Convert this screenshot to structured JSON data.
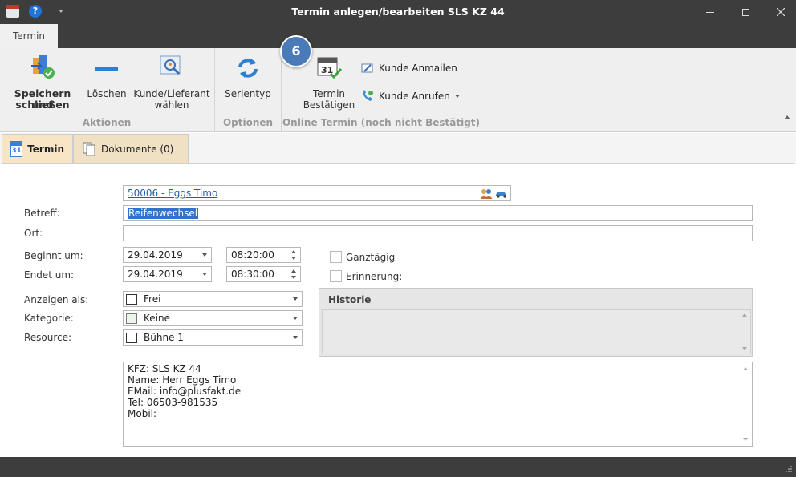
{
  "window": {
    "title": "Termin anlegen/bearbeiten SLS KZ 44"
  },
  "ribbon": {
    "tab": "Termin",
    "badge": "6",
    "groups": {
      "aktionen": "Aktionen",
      "optionen": "Optionen",
      "online": "Online Termin (noch nicht Bestätigt)"
    },
    "buttons": {
      "save_line1": "Speichern und",
      "save_line2": "schließen",
      "delete": "Löschen",
      "pick_line1": "Kunde/Lieferant",
      "pick_line2": "wählen",
      "series": "Serientyp",
      "confirm_line1": "Termin",
      "confirm_line2": "Bestätigen",
      "mail": "Kunde Anmailen",
      "call": "Kunde Anrufen"
    }
  },
  "doctabs": {
    "termin": "Termin",
    "dokumente": "Dokumente (0)",
    "calendar_day": "31"
  },
  "form": {
    "customer_link": "50006 - Eggs Timo",
    "labels": {
      "betreff": "Betreff:",
      "ort": "Ort:",
      "beginnt": "Beginnt um:",
      "endet": "Endet um:",
      "anzeigen": "Anzeigen als:",
      "kategorie": "Kategorie:",
      "resource": "Resource:",
      "ganztaegig": "Ganztägig",
      "erinnerung": "Erinnerung:",
      "historie": "Historie"
    },
    "betreff_value": "Reifenwechsel",
    "ort_value": "",
    "start_date": "29.04.2019",
    "start_time": "08:20:00",
    "end_date": "29.04.2019",
    "end_time": "08:30:00",
    "anzeigen_value": "Frei",
    "kategorie_value": "Keine",
    "resource_value": "Bühne 1",
    "notes": [
      "KFZ: SLS KZ 44",
      "Name: Herr Eggs Timo",
      "EMail: info@plusfakt.de",
      "Tel: 06503-981535",
      "Mobil:"
    ]
  },
  "colors": {
    "titlebar": "#3d3d3d",
    "badge": "#4a7ab8",
    "active_tab": "#f7e5c5",
    "link": "#1f5fa8",
    "selection": "#3173c8"
  }
}
